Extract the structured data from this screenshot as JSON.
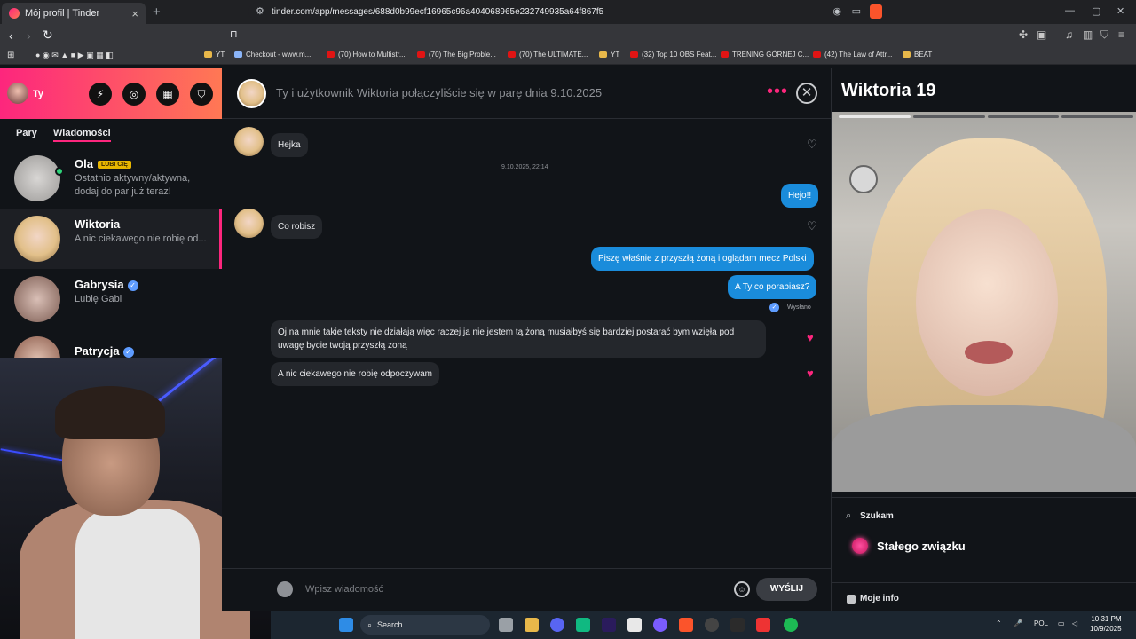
{
  "browser": {
    "tab_title": "Mój profil | Tinder",
    "url": "tinder.com/app/messages/688d0b99ecf16965c96a404068965e232749935a64f867f5",
    "bookmarks": [
      {
        "label": "YT",
        "kind": "folder"
      },
      {
        "label": "Checkout - www.m...",
        "kind": "gen"
      },
      {
        "label": "(70) How to Multistr...",
        "kind": "yt"
      },
      {
        "label": "(70) The Big Proble...",
        "kind": "yt"
      },
      {
        "label": "(70) The ULTIMATE...",
        "kind": "yt"
      },
      {
        "label": "YT",
        "kind": "folder"
      },
      {
        "label": "(32) Top 10 OBS Feat...",
        "kind": "yt"
      },
      {
        "label": "TRENING GÓRNEJ C...",
        "kind": "yt"
      },
      {
        "label": "(42) The Law of Attr...",
        "kind": "yt"
      },
      {
        "label": "BEAT",
        "kind": "folder"
      }
    ]
  },
  "sidebar": {
    "me": "Ty",
    "tabs": [
      "Pary",
      "Wiadomości"
    ],
    "conversations": [
      {
        "name": "Ola",
        "badge": "LUBI CIĘ",
        "preview": "Ostatnio aktywny/aktywna, dodaj do par już teraz!",
        "verified": false
      },
      {
        "name": "Wiktoria",
        "badge": "",
        "preview": "A nic ciekawego nie robię od...",
        "verified": false
      },
      {
        "name": "Gabrysia",
        "badge": "",
        "preview": "Lubię Gabi",
        "verified": true
      },
      {
        "name": "Patrycja",
        "badge": "",
        "preview": "",
        "verified": true
      }
    ]
  },
  "chat": {
    "header": "Ty i użytkownik Wiktoria połączyliście się w parę dnia 9.10.2025",
    "timestamp": "9.10.2025, 22:14",
    "messages": [
      {
        "from": "them",
        "text": "Hejka",
        "liked": false
      },
      {
        "from": "me",
        "text": "Hejo!!"
      },
      {
        "from": "them",
        "text": "Co robisz",
        "liked": false
      },
      {
        "from": "me",
        "text": "Piszę właśnie z przyszłą żoną i oglądam mecz Polski"
      },
      {
        "from": "me",
        "text": "A Ty co porabiasz?"
      },
      {
        "from": "them",
        "text": "Oj na mnie takie teksty nie działają więc raczej ja nie jestem tą żoną musiałbyś się bardziej postarać bym wzięła pod uwagę bycie twoją przyszłą żoną",
        "liked": true
      },
      {
        "from": "them",
        "text": "A nic ciekawego nie robię odpoczywam",
        "liked": true
      }
    ],
    "sent_label": "Wysłano",
    "input_placeholder": "Wpisz wiadomość",
    "send_label": "WYŚLIJ"
  },
  "profile": {
    "name_age": "Wiktoria 19",
    "looking_label": "Szukam",
    "looking_value": "Stałego związku",
    "info_label": "Moje info"
  },
  "taskbar": {
    "search": "Search",
    "lang": "POL",
    "time": "10:31 PM",
    "date": "10/9/2025"
  },
  "colors": {
    "brand_gradient_start": "#fd267d",
    "brand_gradient_end": "#ff7854",
    "outgoing_bubble": "#1a8cdb",
    "incoming_bubble": "#24272c"
  }
}
